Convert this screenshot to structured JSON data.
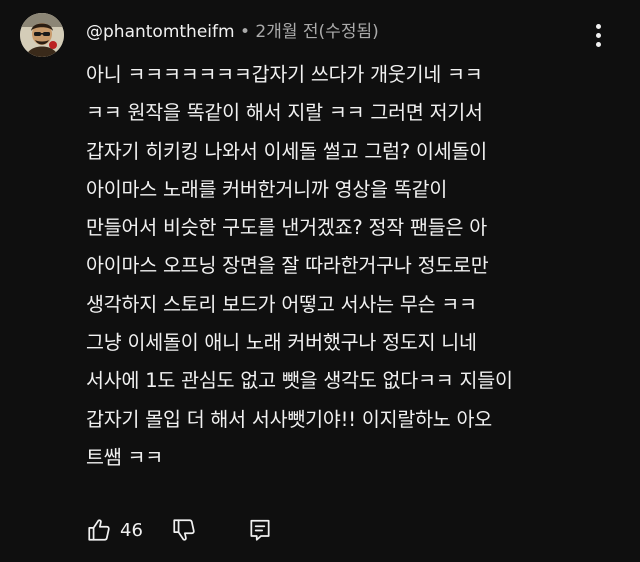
{
  "comment": {
    "author": "@phantomtheifm",
    "separator": " • ",
    "time": "2개월 전",
    "edited": "(수정됨)",
    "lines": [
      "아니 ㅋㅋㅋㅋㅋㅋㅋ갑자기 쓰다가 개웃기네 ㅋㅋ",
      "ㅋㅋ 원작을 똑같이 해서 지랄 ㅋㅋ 그러면 저기서",
      "갑자기 히키킹 나와서 이세돌 썰고 그럼? 이세돌이",
      "아이마스 노래를 커버한거니까 영상을 똑같이",
      "만들어서 비슷한 구도를 낸거겠죠? 정작 팬들은 아",
      "아이마스 오프닝 장면을 잘 따라한거구나 정도로만",
      "생각하지 스토리 보드가 어떻고 서사는 무슨 ㅋㅋ",
      "그냥 이세돌이 애니 노래 커버했구나 정도지 니네",
      "서사에 1도 관심도 없고 뺏을 생각도 없다ㅋㅋ 지들이",
      "갑자기 몰입 더 해서 서사뺏기야!! 이지랄하노 아오",
      "트쌤 ㅋㅋ"
    ]
  },
  "actions": {
    "like_count": "46",
    "like_icon": "thumbs-up-icon",
    "dislike_icon": "thumbs-down-icon",
    "reply_icon": "reply-icon"
  },
  "menu_icon": "more-vert-icon"
}
